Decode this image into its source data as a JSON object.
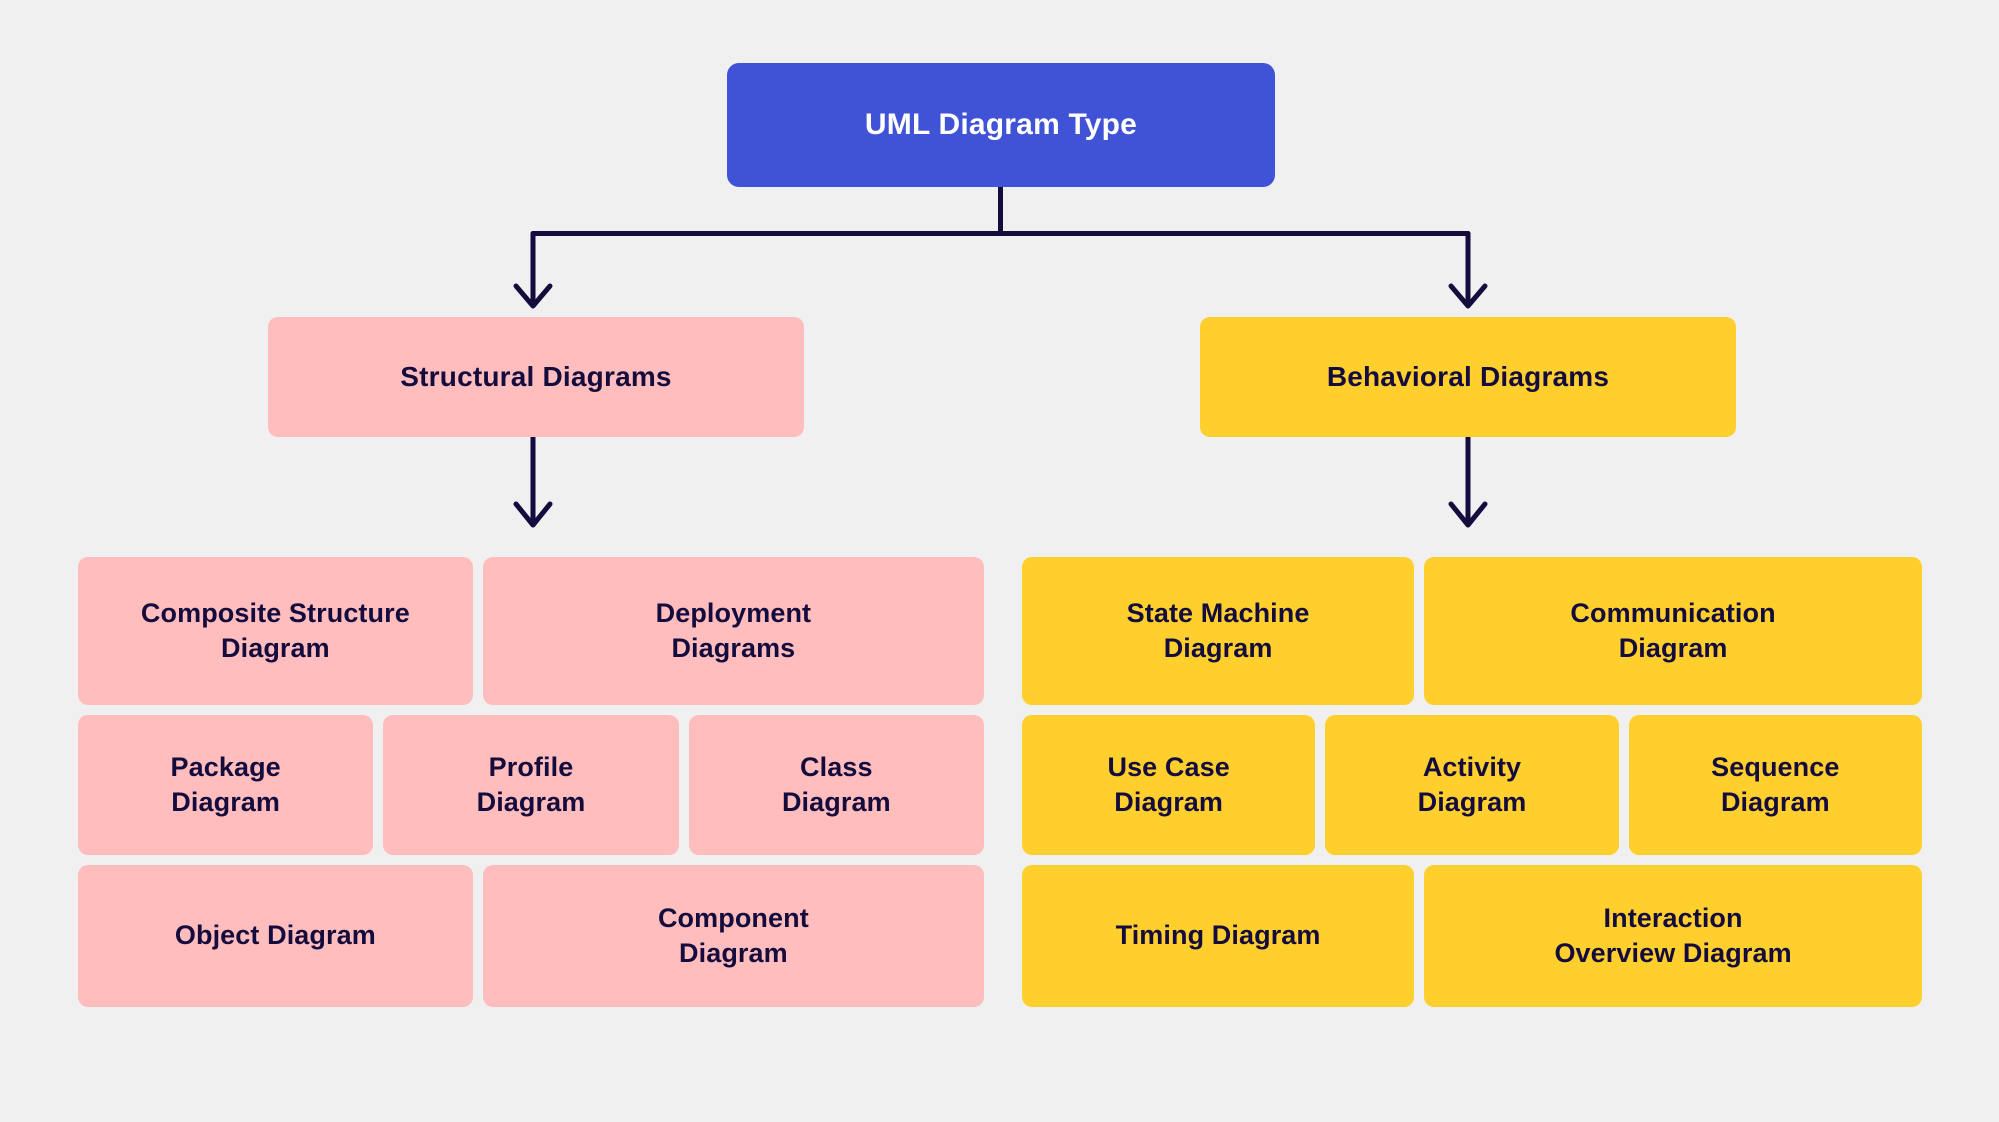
{
  "diagram": {
    "title": "UML Diagram Type",
    "background_color": "#f0f0f0",
    "connector_color": "#150c3e"
  },
  "root": {
    "label": "UML Diagram Type",
    "color": "#4052d6",
    "text_color": "#ffffff"
  },
  "branches": {
    "structural": {
      "label": "Structural Diagrams",
      "color": "#ffbdbd",
      "text_color": "#150c3e"
    },
    "behavioral": {
      "label": "Behavioral Diagrams",
      "color": "#ffcf2e",
      "text_color": "#150c3e"
    }
  },
  "structural_leaves": {
    "rows": [
      [
        {
          "label": "Composite Structure\nDiagram",
          "flex": 352
        },
        {
          "label": "Deployment\nDiagrams",
          "flex": 452
        }
      ],
      [
        {
          "label": "Package\nDiagram",
          "flex": 300
        },
        {
          "label": "Profile\nDiagram",
          "flex": 300
        },
        {
          "label": "Class\nDiagram",
          "flex": 300
        }
      ],
      [
        {
          "label": "Object Diagram",
          "flex": 352
        },
        {
          "label": "Component\nDiagram",
          "flex": 452
        }
      ]
    ]
  },
  "behavioral_leaves": {
    "rows": [
      [
        {
          "label": "State Machine\nDiagram",
          "flex": 352
        },
        {
          "label": "Communication\nDiagram",
          "flex": 452
        }
      ],
      [
        {
          "label": "Use Case\nDiagram",
          "flex": 300
        },
        {
          "label": "Activity\nDiagram",
          "flex": 300
        },
        {
          "label": "Sequence\nDiagram",
          "flex": 300
        }
      ],
      [
        {
          "label": "Timing Diagram",
          "flex": 352
        },
        {
          "label": "Interaction\nOverview Diagram",
          "flex": 452
        }
      ]
    ]
  }
}
